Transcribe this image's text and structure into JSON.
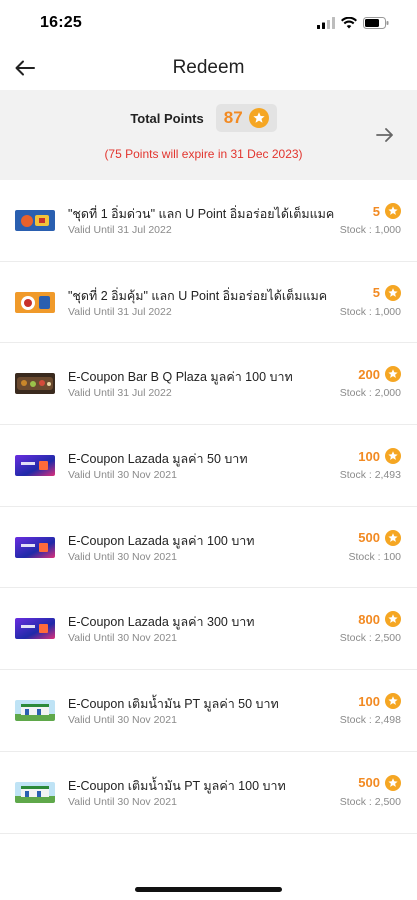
{
  "status_bar": {
    "time": "16:25"
  },
  "header": {
    "title": "Redeem"
  },
  "points_panel": {
    "label": "Total Points",
    "value": "87",
    "expire_note": "(75 Points will expire in 31 Dec 2023)"
  },
  "colors": {
    "accent": "#f28a22",
    "star": "#f5a623",
    "expire": "#e2352e",
    "panel_bg": "#f2f2f2"
  },
  "icons": {
    "back": "arrow-left-icon",
    "forward": "arrow-right-icon",
    "points": "star-icon"
  },
  "items": [
    {
      "title": "\"ชุดที่ 1 อิ่มด่วน\" แลก U Point อิ่มอร่อยได้เต็มแมค",
      "valid": "Valid Until 31 Jul 2022",
      "points": "5",
      "stock": "Stock : 1,000",
      "thumb": "food-1"
    },
    {
      "title": "\"ชุดที่ 2 อิ่มคุ้ม\" แลก U Point อิ่มอร่อยได้เต็มแมค",
      "valid": "Valid Until 31 Jul 2022",
      "points": "5",
      "stock": "Stock : 1,000",
      "thumb": "food-2"
    },
    {
      "title": "E-Coupon Bar B Q Plaza มูลค่า 100 บาท",
      "valid": "Valid Until 31 Jul 2022",
      "points": "200",
      "stock": "Stock : 2,000",
      "thumb": "bbq"
    },
    {
      "title": "E-Coupon Lazada มูลค่า 50 บาท",
      "valid": "Valid Until 30 Nov 2021",
      "points": "100",
      "stock": "Stock : 2,493",
      "thumb": "lazada"
    },
    {
      "title": "E-Coupon Lazada มูลค่า 100 บาท",
      "valid": "Valid Until 30 Nov 2021",
      "points": "500",
      "stock": "Stock : 100",
      "thumb": "lazada"
    },
    {
      "title": "E-Coupon Lazada มูลค่า 300 บาท",
      "valid": "Valid Until 30 Nov 2021",
      "points": "800",
      "stock": "Stock : 2,500",
      "thumb": "lazada"
    },
    {
      "title": "E-Coupon เติมน้ำมัน PT มูลค่า 50 บาท",
      "valid": "Valid Until 30 Nov 2021",
      "points": "100",
      "stock": "Stock : 2,498",
      "thumb": "pt"
    },
    {
      "title": "E-Coupon เติมน้ำมัน PT มูลค่า 100 บาท",
      "valid": "Valid Until 30 Nov 2021",
      "points": "500",
      "stock": "Stock : 2,500",
      "thumb": "pt"
    }
  ]
}
